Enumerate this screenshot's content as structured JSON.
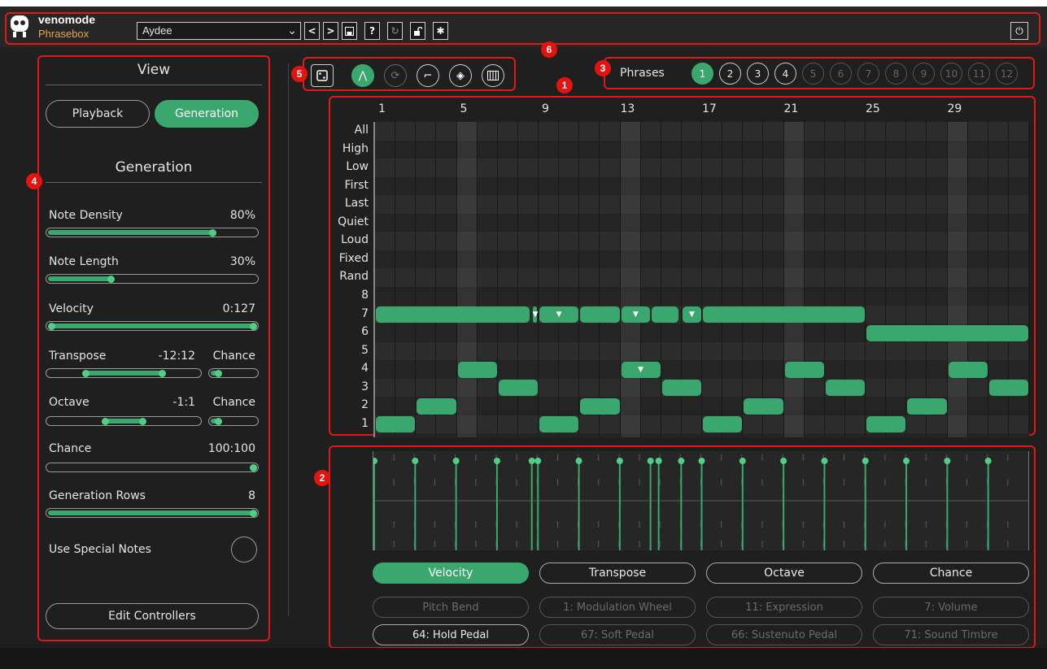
{
  "header": {
    "brand_title": "venomode",
    "brand_subtitle": "Phrasebox",
    "preset_name": "Aydee",
    "icons": [
      "chevron-down-icon",
      "prev-icon",
      "next-icon",
      "save-icon",
      "help-icon",
      "refresh-icon",
      "lock-open-icon",
      "gear-icon",
      "power-icon"
    ]
  },
  "badges": {
    "grid": "1",
    "lanes": "2",
    "phrases": "3",
    "left": "4",
    "tools": "5",
    "header": "6"
  },
  "left_panel": {
    "view_title": "View",
    "view_tabs": [
      {
        "label": "Playback",
        "active": false
      },
      {
        "label": "Generation",
        "active": true
      }
    ],
    "section_title": "Generation",
    "note_density": {
      "label": "Note Density",
      "value": "80%",
      "level": 0.8
    },
    "note_length": {
      "label": "Note Length",
      "value": "30%",
      "level": 0.3
    },
    "velocity": {
      "label": "Velocity",
      "value": "0:127",
      "range": [
        0,
        127
      ]
    },
    "transpose": {
      "label": "Transpose",
      "value": "-12:12",
      "chance_label": "Chance"
    },
    "octave": {
      "label": "Octave",
      "value": "-1:1",
      "chance_label": "Chance"
    },
    "chance": {
      "label": "Chance",
      "value": "100:100"
    },
    "generation_rows": {
      "label": "Generation Rows",
      "value": "8"
    },
    "use_special_notes": {
      "label": "Use Special Notes",
      "on": false
    },
    "edit_controllers": "Edit Controllers"
  },
  "tools": [
    "dice-icon",
    "generate-icon",
    "regenerate-icon",
    "legato-icon",
    "eraser-icon",
    "piano-icon"
  ],
  "phrases": {
    "label": "Phrases",
    "items": [
      "1",
      "2",
      "3",
      "4",
      "5",
      "6",
      "7",
      "8",
      "9",
      "10",
      "11",
      "12"
    ],
    "active": "1",
    "available": 4
  },
  "grid": {
    "col_labels": [
      "1",
      "5",
      "9",
      "13",
      "17",
      "21",
      "25",
      "29"
    ],
    "row_labels": [
      "All",
      "High",
      "Low",
      "First",
      "Last",
      "Quiet",
      "Loud",
      "Fixed",
      "Rand",
      "8",
      "7",
      "6",
      "5",
      "4",
      "3",
      "2",
      "1"
    ],
    "steps": 32,
    "notes": [
      {
        "row": "7",
        "start": 0,
        "len": 7.6
      },
      {
        "row": "7",
        "start": 7.7,
        "len": 0.25,
        "special": true
      },
      {
        "row": "7",
        "start": 8,
        "len": 2,
        "special": true
      },
      {
        "row": "7",
        "start": 10,
        "len": 2
      },
      {
        "row": "7",
        "start": 12,
        "len": 1.5,
        "special": true
      },
      {
        "row": "7",
        "start": 13.5,
        "len": 1.4
      },
      {
        "row": "7",
        "start": 15,
        "len": 1,
        "special": true
      },
      {
        "row": "7",
        "start": 16,
        "len": 8
      },
      {
        "row": "6",
        "start": 24,
        "len": 8
      },
      {
        "row": "4",
        "start": 4,
        "len": 2
      },
      {
        "row": "4",
        "start": 12,
        "len": 2,
        "special": true
      },
      {
        "row": "4",
        "start": 20,
        "len": 2
      },
      {
        "row": "4",
        "start": 28,
        "len": 2
      },
      {
        "row": "3",
        "start": 6,
        "len": 2
      },
      {
        "row": "3",
        "start": 14,
        "len": 2
      },
      {
        "row": "3",
        "start": 22,
        "len": 2
      },
      {
        "row": "3",
        "start": 30,
        "len": 2
      },
      {
        "row": "2",
        "start": 2,
        "len": 2
      },
      {
        "row": "2",
        "start": 10,
        "len": 2
      },
      {
        "row": "2",
        "start": 18,
        "len": 2
      },
      {
        "row": "2",
        "start": 26,
        "len": 2
      },
      {
        "row": "1",
        "start": 0,
        "len": 2
      },
      {
        "row": "1",
        "start": 8,
        "len": 2
      },
      {
        "row": "1",
        "start": 16,
        "len": 2
      },
      {
        "row": "1",
        "start": 24,
        "len": 2
      }
    ]
  },
  "lanes": {
    "velocity_stems": [
      0,
      2,
      4,
      6,
      7.7,
      8,
      10,
      12,
      13.5,
      13.9,
      15,
      16,
      18,
      20,
      22,
      24,
      26,
      28,
      30
    ],
    "primary_tabs": [
      {
        "label": "Velocity",
        "active": true
      },
      {
        "label": "Transpose"
      },
      {
        "label": "Octave"
      },
      {
        "label": "Chance"
      }
    ],
    "controller_row1": [
      {
        "label": "Pitch Bend"
      },
      {
        "label": "1: Modulation Wheel"
      },
      {
        "label": "11: Expression"
      },
      {
        "label": "7: Volume"
      }
    ],
    "controller_row2": [
      {
        "label": "64: Hold Pedal",
        "enabled": true
      },
      {
        "label": "67: Soft Pedal"
      },
      {
        "label": "66: Sustenuto Pedal"
      },
      {
        "label": "71: Sound Timbre"
      }
    ]
  },
  "colors": {
    "accent": "#3aa86e",
    "highlight": "#e01a1a",
    "bg": "#1f1f1f",
    "brand_sub": "#e9a84a"
  }
}
